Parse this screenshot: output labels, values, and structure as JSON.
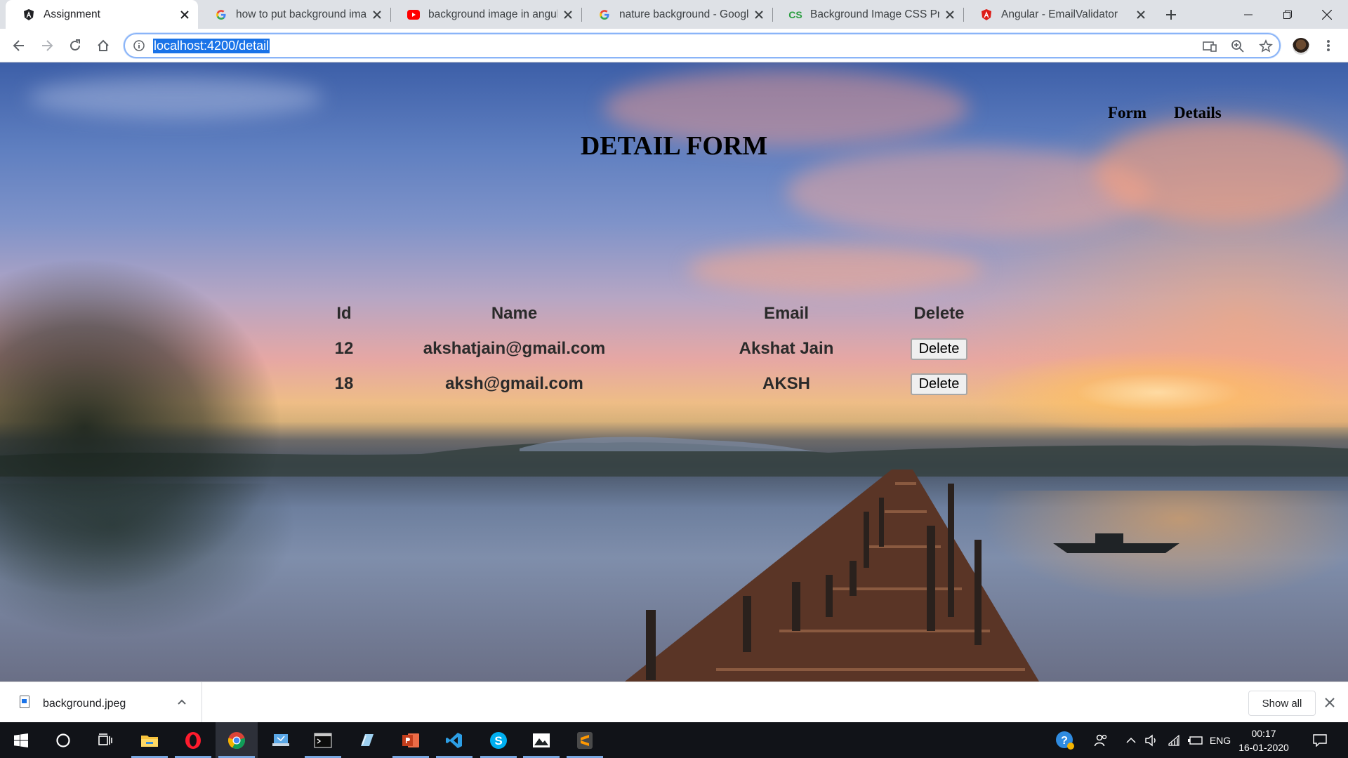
{
  "browser": {
    "tabs": [
      {
        "title": "Assignment",
        "icon": "angular-a-icon",
        "active": true
      },
      {
        "title": "how to put background imag",
        "icon": "google-g-icon"
      },
      {
        "title": "background image in angula",
        "icon": "youtube-icon"
      },
      {
        "title": "nature background - Google",
        "icon": "google-g-icon"
      },
      {
        "title": "Background Image CSS Prop",
        "icon": "css-icon"
      },
      {
        "title": "Angular - EmailValidator",
        "icon": "angular-shield-icon"
      }
    ],
    "address": "localhost:4200/detail"
  },
  "page": {
    "nav": {
      "form": "Form",
      "details": "Details"
    },
    "title": "DETAIL FORM",
    "table": {
      "headers": {
        "id": "Id",
        "name": "Name",
        "email": "Email",
        "delete": "Delete"
      },
      "rows": [
        {
          "id": "12",
          "name": "akshatjain@gmail.com",
          "email": "Akshat Jain",
          "button": "Delete"
        },
        {
          "id": "18",
          "name": "aksh@gmail.com",
          "email": "AKSH",
          "button": "Delete"
        }
      ]
    }
  },
  "downloads": {
    "file": "background.jpeg",
    "show_all": "Show all"
  },
  "taskbar": {
    "apps": [
      "windows-start-icon",
      "cortana-search-icon",
      "task-view-icon",
      "file-explorer-icon",
      "opera-icon",
      "chrome-icon",
      "network-app-icon",
      "terminal-icon",
      "notepad-icon",
      "powerpoint-icon",
      "vscode-icon",
      "skype-icon",
      "photos-icon",
      "sublime-text-icon"
    ],
    "language": "ENG",
    "time": "00:17",
    "date": "16-01-2020"
  },
  "colors": {
    "address_highlight": "#1a73e8",
    "omnibox_focus": "#8ab4f8",
    "taskbar": "#111318"
  }
}
